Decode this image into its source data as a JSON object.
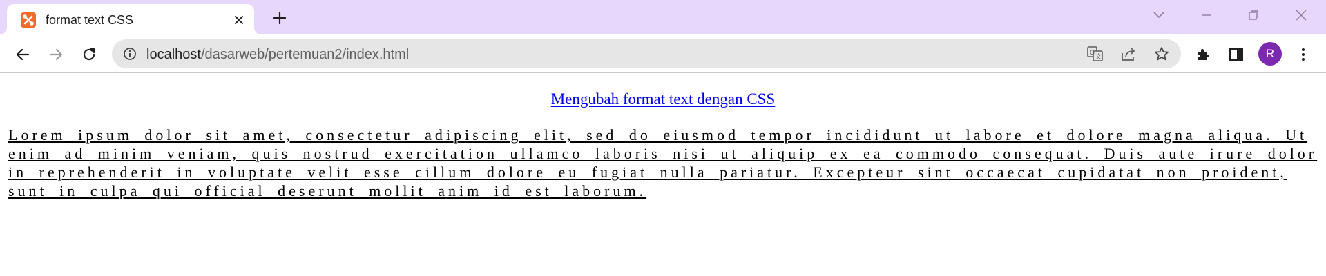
{
  "browser": {
    "tab": {
      "title": "format text CSS",
      "favicon": "xampp-icon"
    },
    "new_tab_icon": "plus-icon",
    "window_controls": [
      "chevron-down-icon",
      "minimize-icon",
      "restore-icon",
      "close-icon"
    ],
    "toolbar": {
      "back_icon": "arrow-left-icon",
      "forward_icon": "arrow-right-icon",
      "reload_icon": "reload-icon",
      "site_info_icon": "info-icon",
      "url_host": "localhost",
      "url_path": "/dasarweb/pertemuan2/index.html",
      "translate_icon": "translate-icon",
      "share_icon": "share-icon",
      "bookmark_icon": "star-icon",
      "extensions_icon": "puzzle-icon",
      "side_panel_icon": "side-panel-icon",
      "profile_initial": "R",
      "menu_icon": "kebab-menu-icon"
    },
    "colors": {
      "tab_strip": "#e8d7fc",
      "profile": "#7b2ab0",
      "link": "#0000ee",
      "favicon": "#ef6c2d"
    }
  },
  "page": {
    "heading": "Mengubah format text dengan CSS",
    "paragraph": "Lorem ipsum dolor sit amet, consectetur adipiscing elit, sed do eiusmod tempor incididunt ut labore et dolore magna aliqua. Ut enim ad minim veniam, quis nostrud exercitation ullamco laboris nisi ut aliquip ex ea commodo consequat. Duis aute irure dolor in reprehenderit in voluptate velit esse cillum dolore eu fugiat nulla pariatur. Excepteur sint occaecat cupidatat non proident, sunt in culpa qui official deserunt mollit anim id est laborum."
  }
}
